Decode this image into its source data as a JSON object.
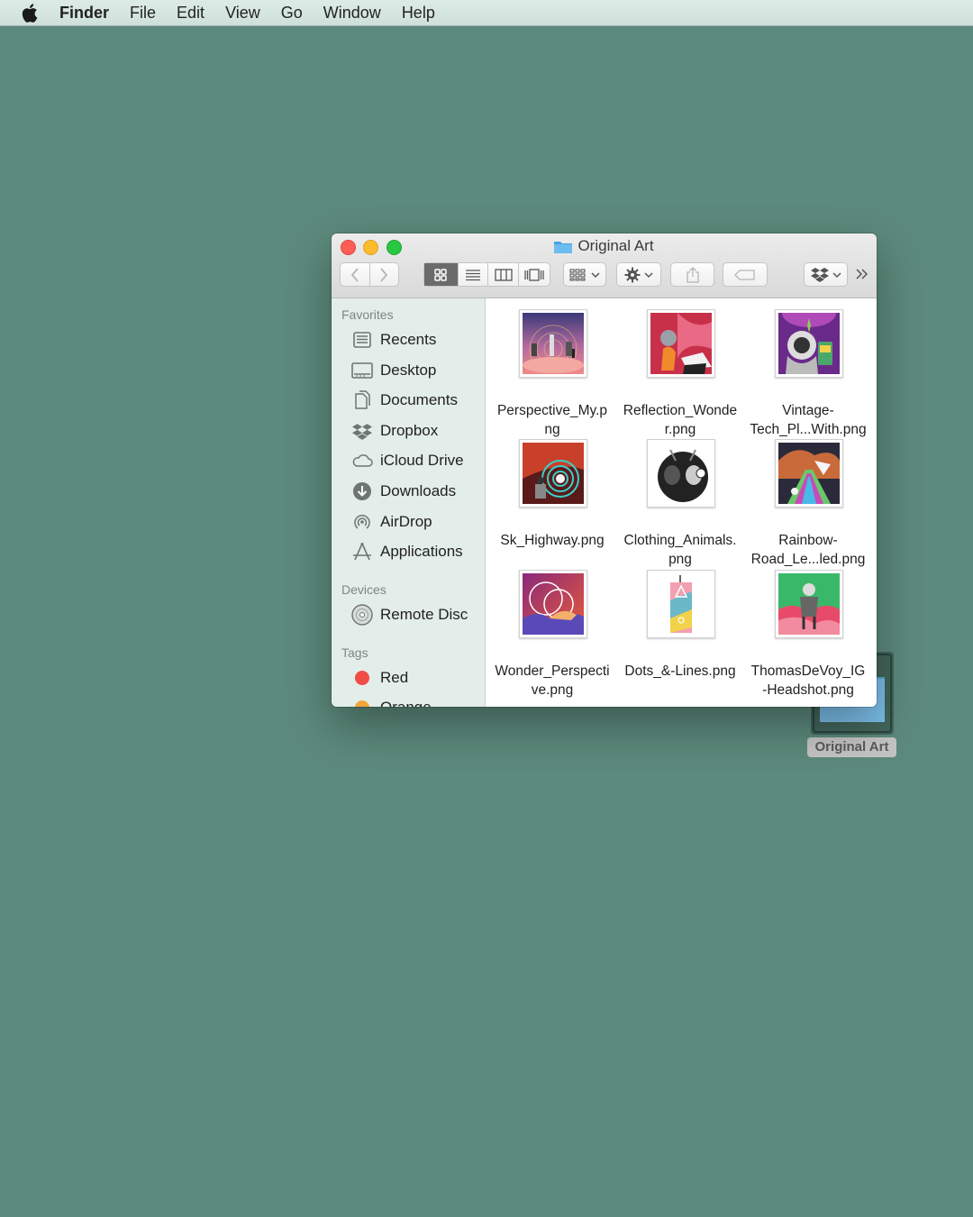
{
  "menubar": {
    "app": "Finder",
    "items": [
      "File",
      "Edit",
      "View",
      "Go",
      "Window",
      "Help"
    ]
  },
  "window": {
    "title": "Original Art",
    "title_icon": "folder-icon"
  },
  "sidebar": {
    "favorites_header": "Favorites",
    "favorites": [
      {
        "label": "Recents",
        "icon": "recents-icon"
      },
      {
        "label": "Desktop",
        "icon": "desktop-icon"
      },
      {
        "label": "Documents",
        "icon": "documents-icon"
      },
      {
        "label": "Dropbox",
        "icon": "dropbox-icon"
      },
      {
        "label": "iCloud Drive",
        "icon": "cloud-icon"
      },
      {
        "label": "Downloads",
        "icon": "downloads-icon"
      },
      {
        "label": "AirDrop",
        "icon": "airdrop-icon"
      },
      {
        "label": "Applications",
        "icon": "applications-icon"
      }
    ],
    "devices_header": "Devices",
    "devices": [
      {
        "label": "Remote Disc",
        "icon": "disc-icon"
      }
    ],
    "tags_header": "Tags",
    "tags": [
      {
        "label": "Red",
        "color": "#f24c47"
      },
      {
        "label": "Orange",
        "color": "#f3a43a"
      }
    ]
  },
  "files": [
    {
      "line1": "Perspective_My.p",
      "line2": "ng"
    },
    {
      "line1": "Reflection_Wonde",
      "line2": "r.png"
    },
    {
      "line1": "Vintage-",
      "line2": "Tech_Pl...With.png"
    },
    {
      "line1": "Sk_Highway.png",
      "line2": ""
    },
    {
      "line1": "Clothing_Animals.",
      "line2": "png"
    },
    {
      "line1": "Rainbow-",
      "line2": "Road_Le...led.png"
    },
    {
      "line1": "Wonder_Perspecti",
      "line2": "ve.png"
    },
    {
      "line1": "Dots_&-Lines.png",
      "line2": ""
    },
    {
      "line1": "ThomasDeVoy_IG",
      "line2": "-Headshot.png"
    }
  ],
  "desktop": {
    "folder_label": "Original Art"
  },
  "colors": {
    "desktop": "#5c8a7c",
    "sidebar": "#e3ede9",
    "close": "#fd5f57",
    "minimize": "#febb2e",
    "maximize": "#28c840"
  }
}
